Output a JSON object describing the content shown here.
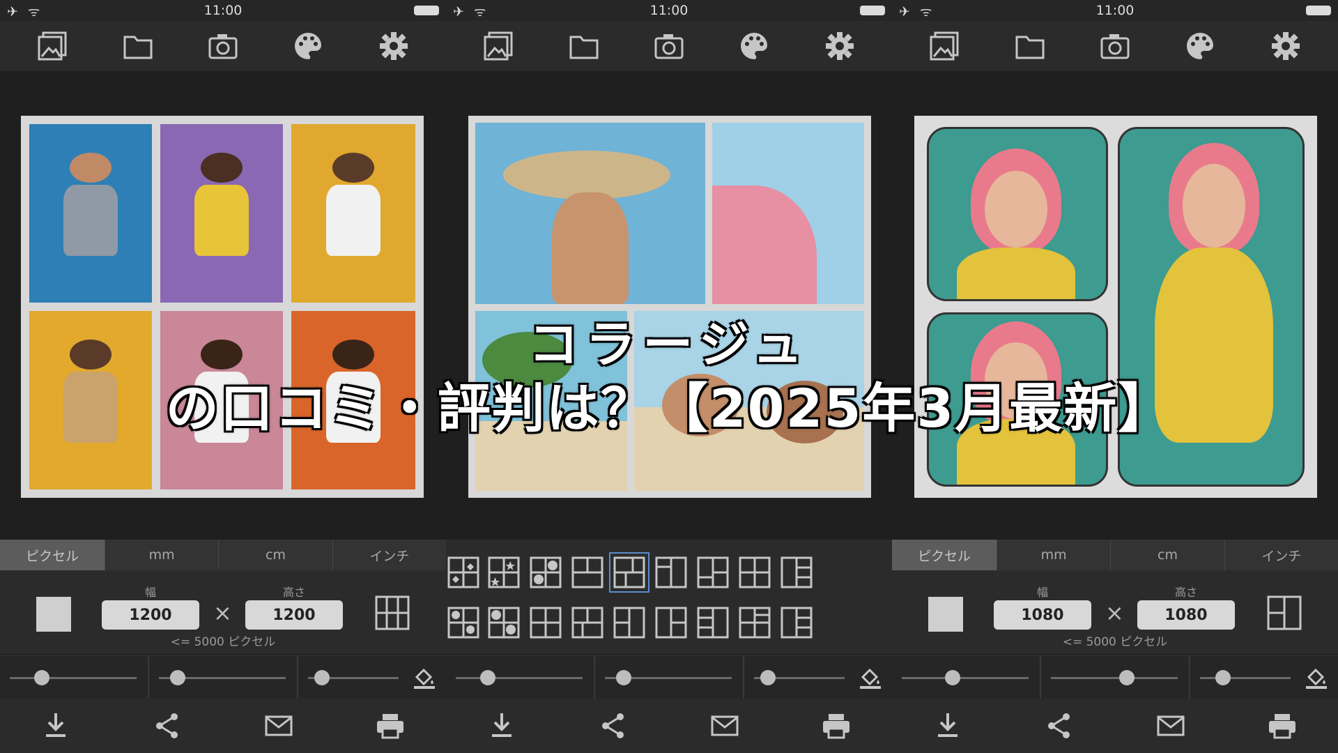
{
  "headline": {
    "line1": "コラージュ",
    "line2": "の口コミ・評判は？【2025年3月最新】"
  },
  "status": {
    "time": "11:00",
    "left": "✈ ᯤ"
  },
  "units": [
    "ピクセル",
    "mm",
    "cm",
    "インチ"
  ],
  "panels": [
    {
      "dims": {
        "width_label": "幅",
        "height_label": "高さ",
        "width": "1200",
        "height": "1200",
        "times": "×",
        "limit": "<= 5000 ピクセル"
      },
      "sliders": [
        0.25,
        0.15,
        0.15
      ]
    },
    {
      "sliders": [
        0.25,
        0.15,
        0.15
      ]
    },
    {
      "dims": {
        "width_label": "幅",
        "height_label": "高さ",
        "width": "1080",
        "height": "1080",
        "times": "×",
        "limit": "<= 5000 ピクセル"
      },
      "sliders": [
        0.4,
        0.6,
        0.25
      ]
    }
  ],
  "colors": {
    "blue": "#2e7fb6",
    "purple": "#8a68b3",
    "yellow": "#e0a82e",
    "yellow2": "#e3a92c",
    "pink": "#c98797",
    "orange": "#d9652a",
    "teal": "#3d9b90",
    "sky": "#6fb3d6",
    "sand": "#e3d2b0"
  }
}
